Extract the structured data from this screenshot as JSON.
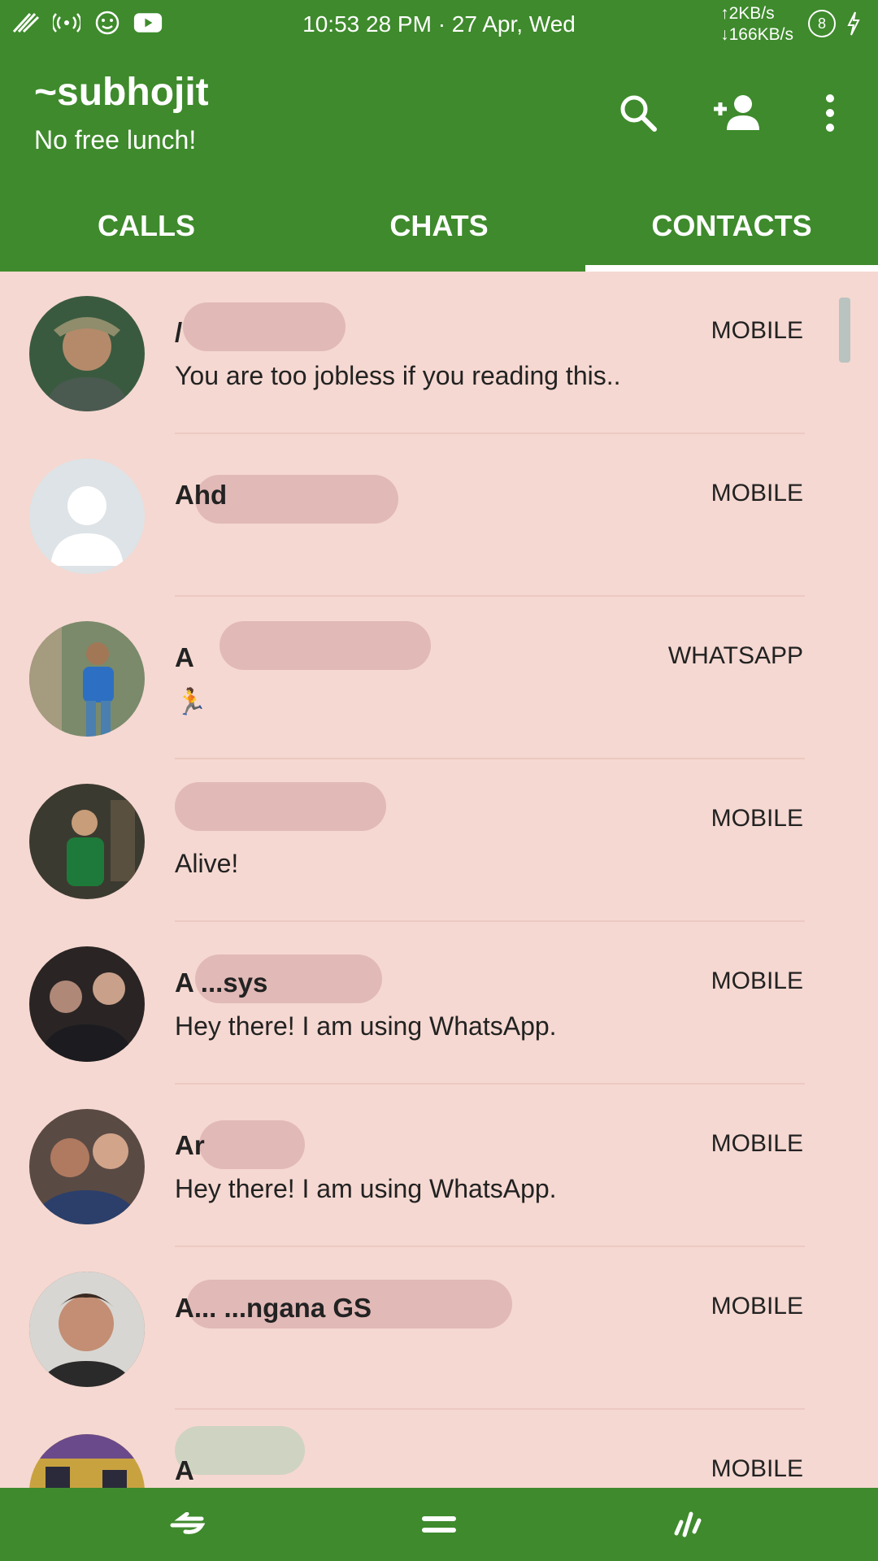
{
  "status_bar": {
    "time": "10:53 28 PM · 27 Apr, Wed",
    "net_up": "↑2KB/s",
    "net_down": "↓166KB/s",
    "battery": "8",
    "icons": [
      "signal-icon",
      "wifi-hotspot-icon",
      "face-icon",
      "youtube-icon"
    ]
  },
  "header": {
    "title": "~subhojit",
    "subtitle": "No free lunch!",
    "actions": [
      "search-icon",
      "add-contact-icon",
      "more-vert-icon"
    ]
  },
  "tabs": [
    {
      "label": "CALLS",
      "active": false
    },
    {
      "label": "CHATS",
      "active": false
    },
    {
      "label": "CONTACTS",
      "active": true
    }
  ],
  "contacts": [
    {
      "name": "/",
      "status": "You are too jobless if you reading this..",
      "type": "MOBILE",
      "avatar_color": "#3a5a3f"
    },
    {
      "name": "Ahd",
      "status": "",
      "type": "MOBILE",
      "avatar_color": "#dde3e6"
    },
    {
      "name": "A",
      "status": "🏃",
      "type": "WHATSAPP",
      "avatar_color": "#7a8a6b"
    },
    {
      "name": "",
      "status": "Alive!",
      "type": "MOBILE",
      "avatar_color": "#3b3a30"
    },
    {
      "name": "A  ...sys",
      "status": "Hey there! I am using WhatsApp.",
      "type": "MOBILE",
      "avatar_color": "#2a2524"
    },
    {
      "name": "Ar",
      "status": "Hey there! I am using WhatsApp.",
      "type": "MOBILE",
      "avatar_color": "#5a4a44"
    },
    {
      "name": "A... ...ngana GS",
      "status": "",
      "type": "MOBILE",
      "avatar_color": "#6b5a50"
    },
    {
      "name": "A",
      "status": "",
      "type": "MOBILE",
      "avatar_color": "#c9a240"
    }
  ],
  "colors": {
    "primary": "#3e8a2c",
    "list_bg": "#f5d8d1"
  }
}
